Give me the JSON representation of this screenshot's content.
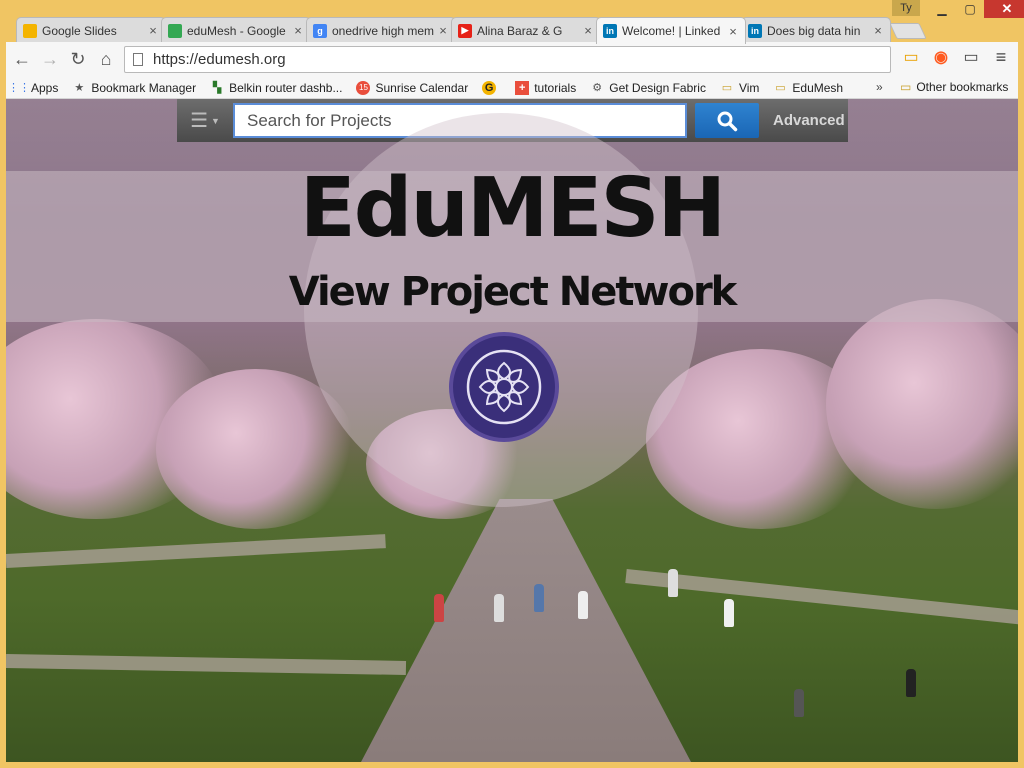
{
  "browser": {
    "tabs": [
      {
        "label": "Google Slides",
        "favicon_color": "#f4b400",
        "active": false
      },
      {
        "label": "eduMesh - Google",
        "favicon_color": "#34a853",
        "active": false
      },
      {
        "label": "onedrive high mem",
        "favicon_color": "#4285f4",
        "favicon_text": "g",
        "active": false
      },
      {
        "label": "Alina Baraz & G",
        "favicon_color": "#e62117",
        "active": false
      },
      {
        "label": "Welcome! | Linked",
        "favicon_color": "#0077b5",
        "favicon_text": "in",
        "active": true
      },
      {
        "label": "Does big data hin",
        "favicon_color": "#0077b5",
        "favicon_text": "in",
        "active": false
      }
    ],
    "user_badge": "Ty",
    "url": "https://edumesh.org",
    "bookmarks": [
      {
        "label": "Apps",
        "icon": "apps-grid-icon"
      },
      {
        "label": "Bookmark Manager",
        "icon": "star-icon"
      },
      {
        "label": "Belkin router dashb...",
        "icon": "router-icon"
      },
      {
        "label": "Sunrise Calendar",
        "icon": "calendar-icon",
        "badge": "15"
      },
      {
        "label": "",
        "icon": "g-icon"
      },
      {
        "label": "tutorials",
        "icon": "plus-icon"
      },
      {
        "label": "Get Design Fabric",
        "icon": "gear-icon"
      },
      {
        "label": "Vim",
        "icon": "folder-icon"
      },
      {
        "label": "EduMesh",
        "icon": "folder-icon"
      }
    ],
    "bookmarks_more": "»",
    "other_bookmarks": "Other bookmarks"
  },
  "page": {
    "search": {
      "placeholder": "Search for Projects",
      "advanced_label": "Advanced"
    },
    "hero": {
      "title": "EduMESH",
      "subtitle": "View Project Network"
    }
  }
}
